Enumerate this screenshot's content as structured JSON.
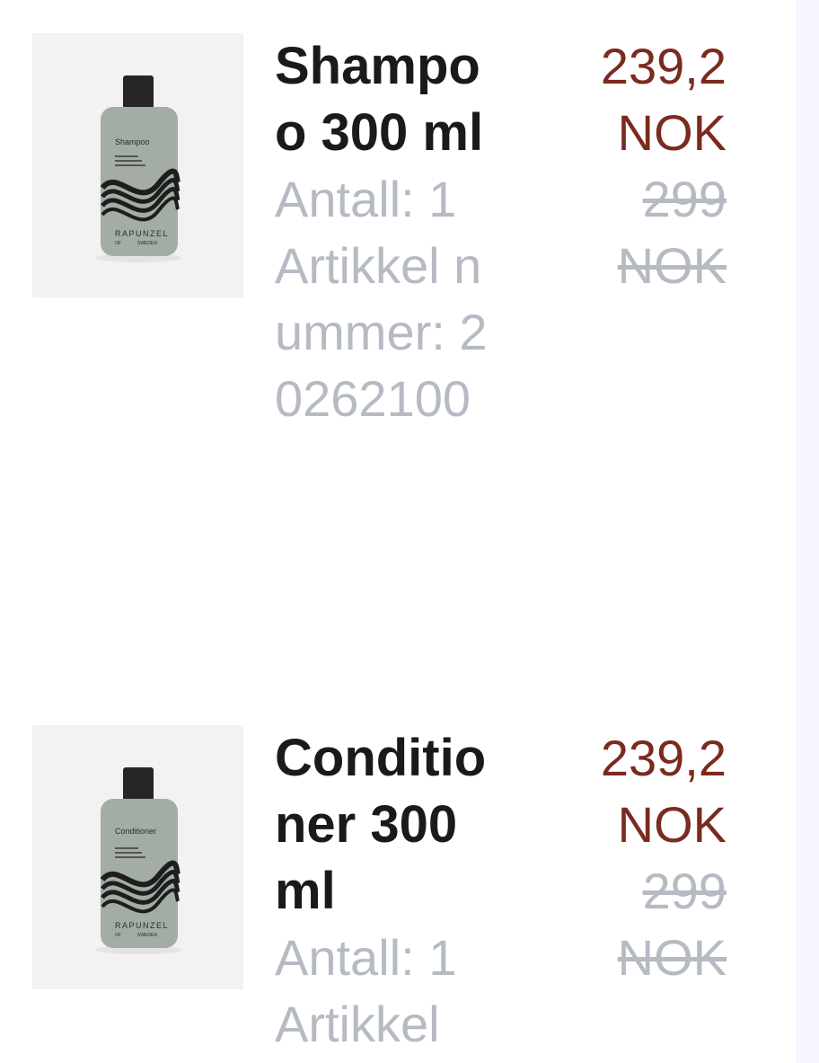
{
  "items": [
    {
      "name": "Shampoo 300 ml",
      "quantity": "Antall: 1",
      "article": "Artikkel nummer: 20262100",
      "sale_price": "239,2 NOK",
      "original_price": "299 NOK",
      "image_label": "Shampoo",
      "brand": "RAPUNZEL",
      "brand_sub_left": "OF",
      "brand_sub_right": "SWEDEN"
    },
    {
      "name": "Conditioner 300 ml",
      "quantity": "Antall: 1",
      "article": "Artikkel",
      "sale_price": "239,2 NOK",
      "original_price": "299 NOK",
      "image_label": "Conditioner",
      "brand": "RAPUNZEL",
      "brand_sub_left": "OF",
      "brand_sub_right": "SWEDEN"
    }
  ],
  "colors": {
    "sale": "#7b2a1f",
    "muted": "#b5bac3",
    "title": "#1a1a1a",
    "bottle": "#a3ada3"
  }
}
